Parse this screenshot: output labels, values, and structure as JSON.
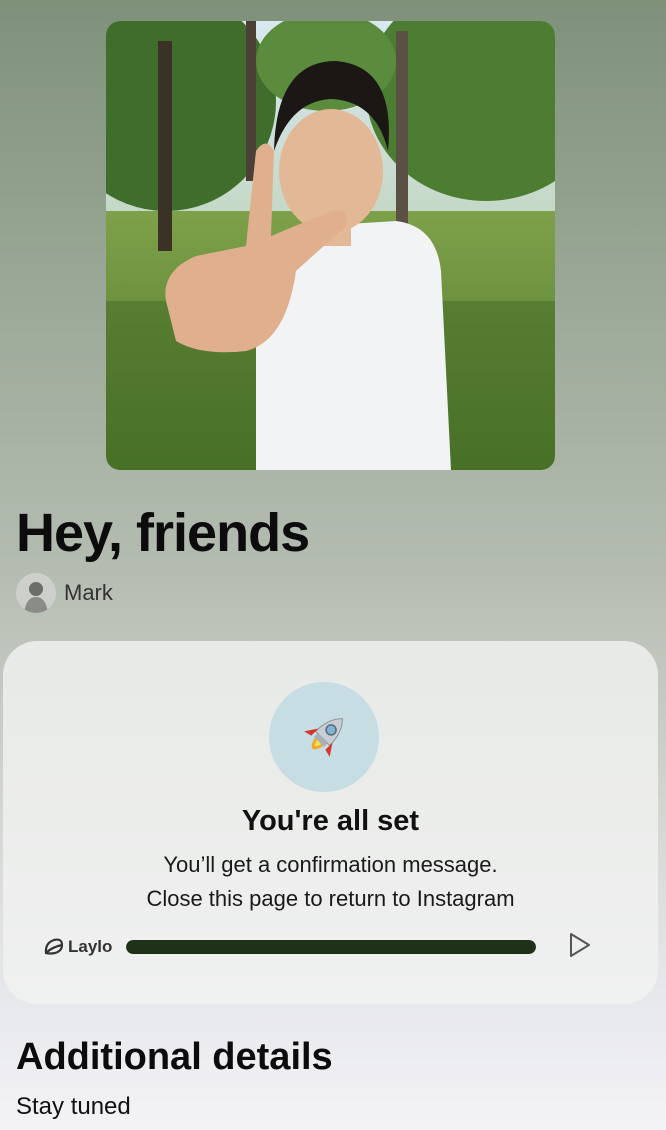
{
  "post": {
    "title": "Hey, friends",
    "author": "Mark"
  },
  "card": {
    "title": "You're all set",
    "message_line1": "You’ll get a confirmation message.",
    "message_line2": "Close this page to return to Instagram",
    "icon": "rocket-icon",
    "circle_color": "#c5dde3"
  },
  "player": {
    "brand": "Laylo",
    "progress": 1.0,
    "progress_color": "#1e3219"
  },
  "details": {
    "title": "Additional details",
    "body": "Stay tuned"
  }
}
